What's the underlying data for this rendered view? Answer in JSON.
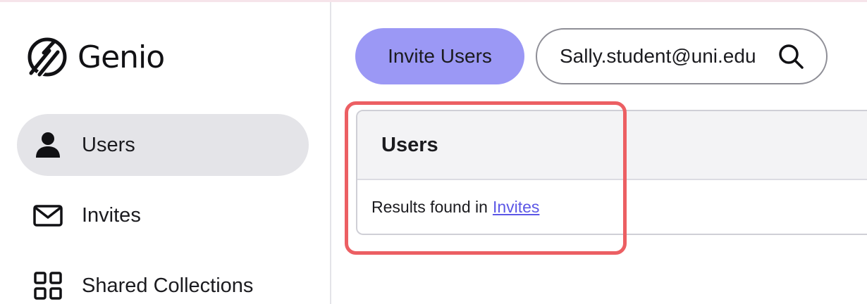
{
  "app": {
    "name": "Genio"
  },
  "sidebar": {
    "items": [
      {
        "label": "Users",
        "icon": "user-icon",
        "active": true
      },
      {
        "label": "Invites",
        "icon": "mail-icon",
        "active": false
      },
      {
        "label": "Shared Collections",
        "icon": "grid-icon",
        "active": false
      }
    ]
  },
  "toolbar": {
    "invite_label": "Invite Users",
    "search_value": "Sally.student@uni.edu"
  },
  "results": {
    "title": "Users",
    "text": "Results found in",
    "link": "Invites"
  },
  "colors": {
    "accent": "#9b98f5",
    "highlight": "#ec5f63",
    "link": "#5c57e6"
  }
}
